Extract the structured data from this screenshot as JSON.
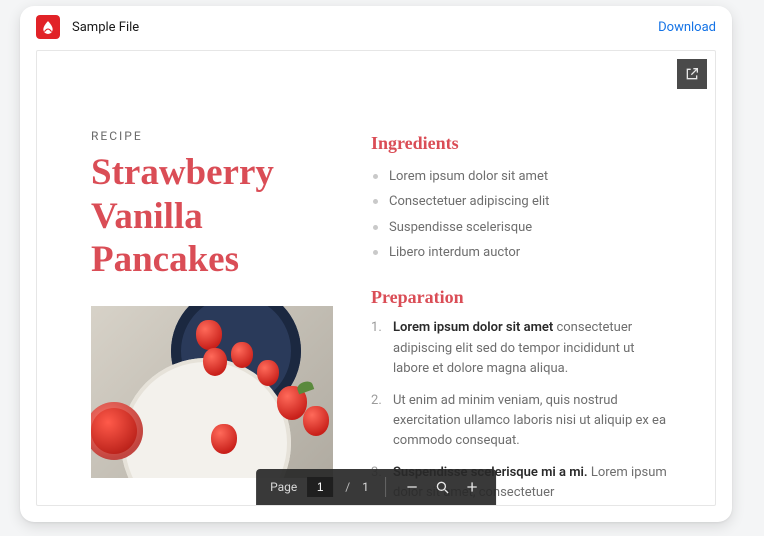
{
  "header": {
    "file_title": "Sample File",
    "download_label": "Download"
  },
  "document": {
    "overline": "RECIPE",
    "title": "Strawberry Vanilla Pancakes",
    "sections": {
      "ingredients": {
        "heading": "Ingredients",
        "items": [
          "Lorem ipsum dolor sit amet",
          "Consectetuer adipiscing elit",
          "Suspendisse scelerisque",
          "Libero interdum auctor"
        ]
      },
      "preparation": {
        "heading": "Preparation",
        "steps": [
          {
            "lead": "Lorem ipsum dolor sit amet",
            "rest": " consectetuer adipiscing elit sed do tempor incididunt ut labore et dolore magna aliqua."
          },
          {
            "lead": "",
            "rest": "Ut enim ad minim veniam, quis nostrud exercitation ullamco laboris nisi ut aliquip ex ea commodo consequat."
          },
          {
            "lead": "Suspendisse scelerisque mi a mi.",
            "rest": " Lorem ipsum dolor sit amet, consectetuer"
          }
        ]
      }
    }
  },
  "toolbar": {
    "page_label": "Page",
    "current_page": "1",
    "separator": "/",
    "total_pages": "1"
  }
}
